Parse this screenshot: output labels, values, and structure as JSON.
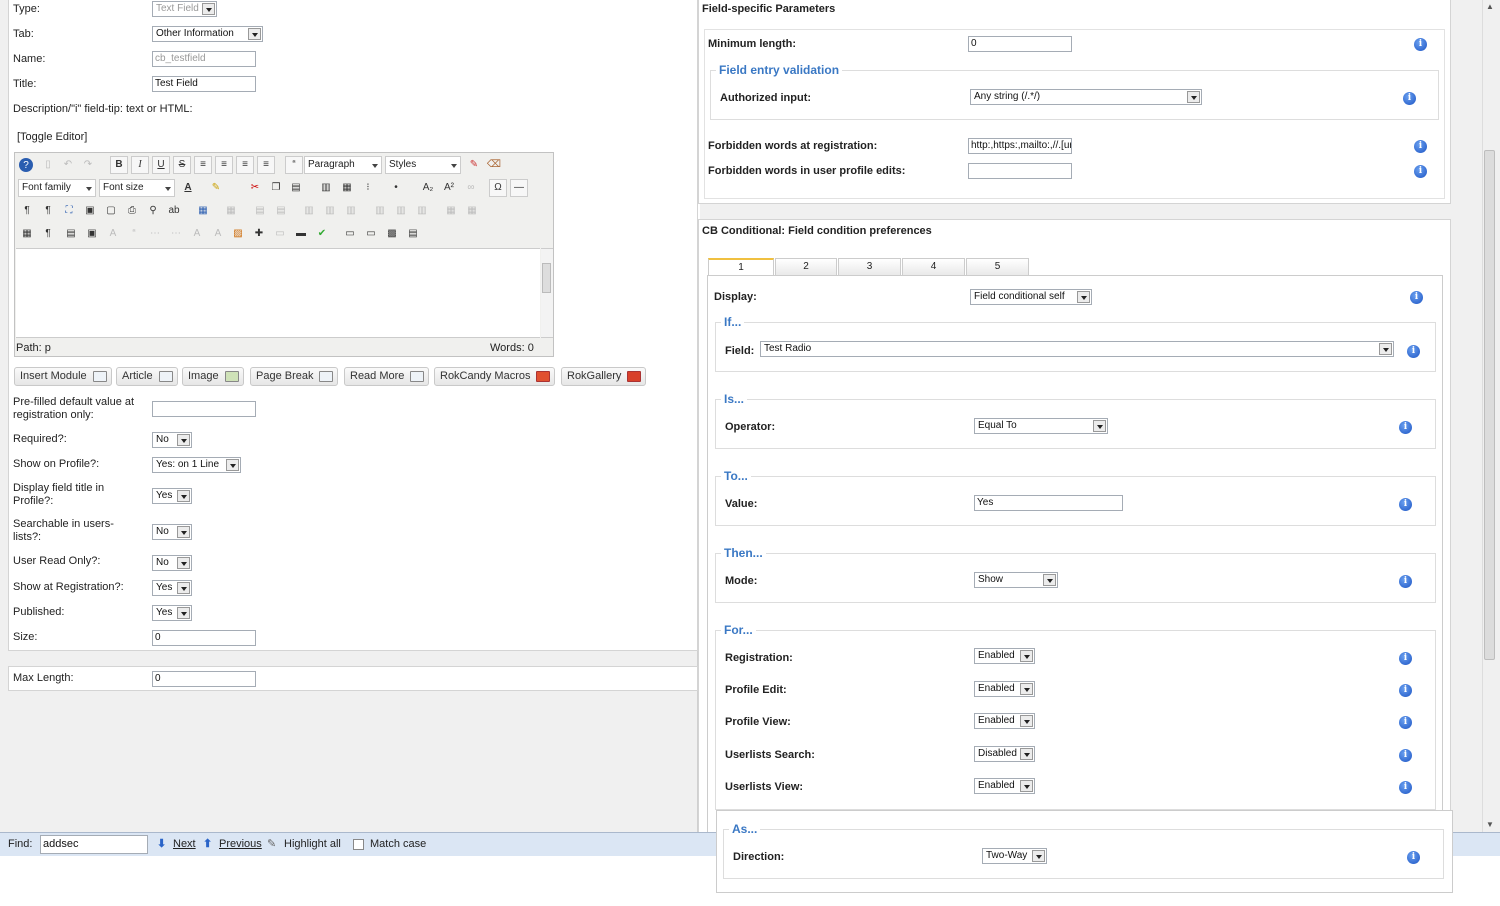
{
  "left": {
    "type_label": "Type:",
    "type_value": "Text Field",
    "tab_label": "Tab:",
    "tab_value": "Other Information",
    "name_label": "Name:",
    "name_value": "cb_testfield",
    "title_label": "Title:",
    "title_value": "Test Field",
    "desc_label": "Description/\"i\" field-tip: text or HTML:",
    "toggle_editor": "[Toggle Editor]",
    "editor": {
      "format_value": "Paragraph",
      "styles_value": "Styles",
      "font_family": "Font family",
      "font_size": "Font size",
      "path_label": "Path:",
      "path_value": "p",
      "words": "Words: 0"
    },
    "plugin_buttons": [
      {
        "label": "Insert Module"
      },
      {
        "label": "Article"
      },
      {
        "label": "Image"
      },
      {
        "label": "Page Break"
      },
      {
        "label": "Read More"
      },
      {
        "label": "RokCandy Macros"
      },
      {
        "label": "RokGallery"
      }
    ],
    "prefilled_label": "Pre-filled default value at registration only:",
    "prefilled_value": "",
    "required_label": "Required?:",
    "required_value": "No",
    "show_profile_label": "Show on Profile?:",
    "show_profile_value": "Yes: on 1 Line",
    "display_title_label": "Display field title in Profile?:",
    "display_title_value": "Yes",
    "searchable_label": "Searchable in users-lists?:",
    "searchable_value": "No",
    "readonly_label": "User Read Only?:",
    "readonly_value": "No",
    "show_reg_label": "Show at Registration?:",
    "show_reg_value": "Yes",
    "published_label": "Published:",
    "published_value": "Yes",
    "size_label": "Size:",
    "size_value": "0",
    "maxlen_label": "Max Length:",
    "maxlen_value": "0"
  },
  "right": {
    "fsp_title": "Field-specific Parameters",
    "minlen_label": "Minimum length:",
    "minlen_value": "0",
    "validation_legend": "Field entry validation",
    "authorized_label": "Authorized input:",
    "authorized_value": "Any string (/.*/)",
    "forbidden_reg_label": "Forbidden words at registration:",
    "forbidden_reg_value": "http:,https:,mailto:,//.[url",
    "forbidden_edit_label": "Forbidden words in user profile edits:",
    "forbidden_edit_value": "",
    "cond_title": "CB Conditional: Field condition preferences",
    "tabs": [
      "1",
      "2",
      "3",
      "4",
      "5"
    ],
    "display_label": "Display:",
    "display_value": "Field conditional self",
    "if_legend": "If...",
    "field_label": "Field:",
    "field_value": "Test Radio",
    "is_legend": "Is...",
    "operator_label": "Operator:",
    "operator_value": "Equal To",
    "to_legend": "To...",
    "value_label": "Value:",
    "value_value": "Yes",
    "then_legend": "Then...",
    "mode_label": "Mode:",
    "mode_value": "Show",
    "for_legend": "For...",
    "registration_label": "Registration:",
    "registration_value": "Enabled",
    "profile_edit_label": "Profile Edit:",
    "profile_edit_value": "Enabled",
    "profile_view_label": "Profile View:",
    "profile_view_value": "Enabled",
    "userlists_search_label": "Userlists Search:",
    "userlists_search_value": "Disabled",
    "userlists_view_label": "Userlists View:",
    "userlists_view_value": "Enabled",
    "as_legend": "As...",
    "direction_label": "Direction:",
    "direction_value": "Two-Way"
  },
  "findbar": {
    "find_label": "Find:",
    "find_value": "addsec",
    "next": "Next",
    "previous": "Previous",
    "highlight": "Highlight all",
    "match_case": "Match case"
  }
}
